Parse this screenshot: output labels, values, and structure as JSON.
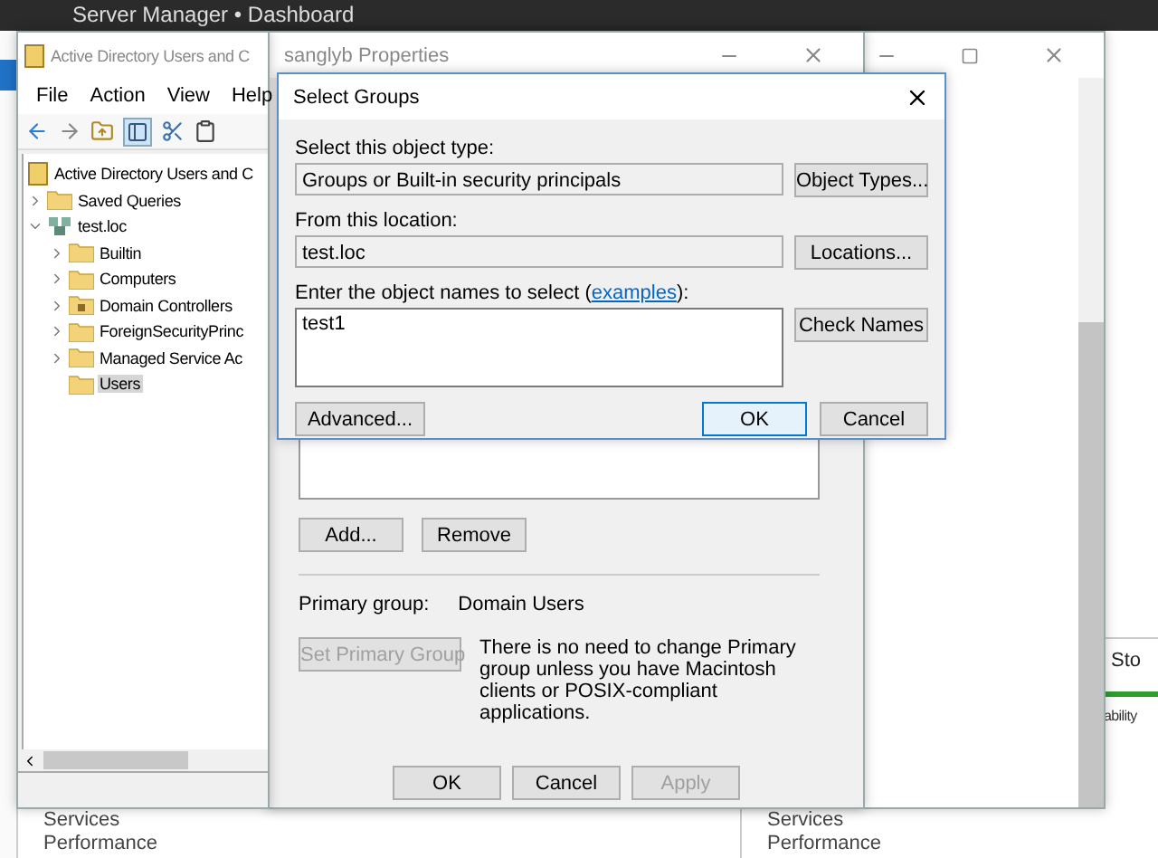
{
  "server_manager": {
    "title": "Server Manager • Dashboard",
    "side_texts": [
      "Sto",
      "ability"
    ],
    "bottom_tiles": [
      {
        "lines": [
          "Services",
          "Performance"
        ]
      },
      {
        "lines": [
          "Services",
          "Performance"
        ]
      }
    ]
  },
  "aduc": {
    "title": "Active Directory Users and C",
    "menu": [
      "File",
      "Action",
      "View",
      "Help"
    ],
    "tree": [
      {
        "label": "Active Directory Users and C",
        "kind": "root",
        "selected": false,
        "children": [
          {
            "label": "Saved Queries",
            "kind": "folder",
            "expanded": false,
            "selected": false
          },
          {
            "label": "test.loc",
            "kind": "domain",
            "expanded": true,
            "selected": false,
            "children": [
              {
                "label": "Builtin",
                "kind": "folder",
                "expanded": false,
                "selected": false
              },
              {
                "label": "Computers",
                "kind": "folder",
                "expanded": false,
                "selected": false
              },
              {
                "label": "Domain Controllers",
                "kind": "ou",
                "expanded": false,
                "selected": false
              },
              {
                "label": "ForeignSecurityPrinc",
                "kind": "folder",
                "expanded": false,
                "selected": false
              },
              {
                "label": "Managed Service Ac",
                "kind": "folder",
                "expanded": false,
                "selected": false
              },
              {
                "label": "Users",
                "kind": "folder",
                "selected": true
              }
            ]
          }
        ]
      }
    ]
  },
  "properties": {
    "title": "sanglyb Properties",
    "list_buttons": [
      "Add...",
      "Remove"
    ],
    "primary_group_label": "Primary group:",
    "primary_group": "Domain Users",
    "set_primary": {
      "label": "Set Primary Group",
      "disabled": true
    },
    "note": "There is no need to change Primary group unless you have Macintosh clients or POSIX-compliant applications.",
    "footer_buttons": [
      {
        "label": "OK",
        "disabled": false
      },
      {
        "label": "Cancel",
        "disabled": false
      },
      {
        "label": "Apply",
        "disabled": true
      }
    ]
  },
  "select_groups": {
    "title": "Select Groups",
    "object_type_label": "Select this object type:",
    "object_type": "Groups or Built-in security principals",
    "object_types_button": "Object Types...",
    "location_label": "From this location:",
    "location": "test.loc",
    "locations_button": "Locations...",
    "names_label": "Enter the object names to select (",
    "names_link": "examples",
    "names_label_end": "):",
    "names_value": "test1",
    "check_names_button": "Check Names",
    "advanced_button": "Advanced...",
    "ok_button": "OK",
    "cancel_button": "Cancel"
  }
}
